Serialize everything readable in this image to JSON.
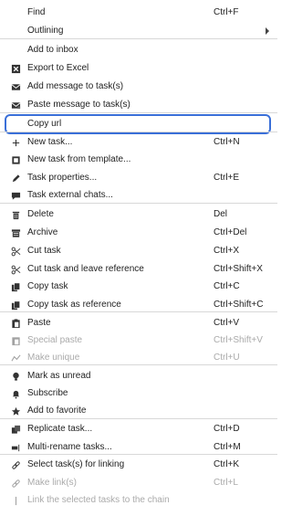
{
  "menu": {
    "items": [
      {
        "label": "Find",
        "shortcut": "Ctrl+F",
        "icon": "none",
        "disabled": false
      },
      {
        "label": "Outlining",
        "shortcut": "",
        "icon": "none",
        "disabled": false,
        "submenu": true
      },
      {
        "label": "Add to inbox",
        "shortcut": "",
        "icon": "none",
        "disabled": false
      },
      {
        "label": "Export to Excel",
        "shortcut": "",
        "icon": "excel-icon",
        "disabled": false
      },
      {
        "label": "Add message to task(s)",
        "shortcut": "",
        "icon": "envelope-icon",
        "disabled": false
      },
      {
        "label": "Paste message to task(s)",
        "shortcut": "",
        "icon": "envelope-paste-icon",
        "disabled": false
      },
      {
        "label": "Copy url",
        "shortcut": "",
        "icon": "none",
        "disabled": false
      },
      {
        "label": "New task...",
        "shortcut": "Ctrl+N",
        "icon": "plus-icon",
        "disabled": false
      },
      {
        "label": "New task from template...",
        "shortcut": "",
        "icon": "template-icon",
        "disabled": false
      },
      {
        "label": "Task properties...",
        "shortcut": "Ctrl+E",
        "icon": "pencil-icon",
        "disabled": false
      },
      {
        "label": "Task external chats...",
        "shortcut": "",
        "icon": "chat-icon",
        "disabled": false
      },
      {
        "label": "Delete",
        "shortcut": "Del",
        "icon": "trash-icon",
        "disabled": false
      },
      {
        "label": "Archive",
        "shortcut": "Ctrl+Del",
        "icon": "archive-icon",
        "disabled": false
      },
      {
        "label": "Cut task",
        "shortcut": "Ctrl+X",
        "icon": "scissors-icon",
        "disabled": false
      },
      {
        "label": "Cut task and leave reference",
        "shortcut": "Ctrl+Shift+X",
        "icon": "scissors-ref-icon",
        "disabled": false
      },
      {
        "label": "Copy task",
        "shortcut": "Ctrl+C",
        "icon": "copy-icon",
        "disabled": false
      },
      {
        "label": "Copy task as reference",
        "shortcut": "Ctrl+Shift+C",
        "icon": "copy-ref-icon",
        "disabled": false
      },
      {
        "label": "Paste",
        "shortcut": "Ctrl+V",
        "icon": "paste-icon",
        "disabled": false
      },
      {
        "label": "Special paste",
        "shortcut": "Ctrl+Shift+V",
        "icon": "special-paste-icon",
        "disabled": true
      },
      {
        "label": "Make unique",
        "shortcut": "Ctrl+U",
        "icon": "unique-icon",
        "disabled": true
      },
      {
        "label": "Mark as unread",
        "shortcut": "",
        "icon": "bulb-icon",
        "disabled": false
      },
      {
        "label": "Subscribe",
        "shortcut": "",
        "icon": "bell-icon",
        "disabled": false
      },
      {
        "label": "Add to favorite",
        "shortcut": "",
        "icon": "star-icon",
        "disabled": false
      },
      {
        "label": "Replicate task...",
        "shortcut": "Ctrl+D",
        "icon": "replicate-icon",
        "disabled": false
      },
      {
        "label": "Multi-rename tasks...",
        "shortcut": "Ctrl+M",
        "icon": "rename-icon",
        "disabled": false
      },
      {
        "label": "Select task(s) for linking",
        "shortcut": "Ctrl+K",
        "icon": "link-icon",
        "disabled": false
      },
      {
        "label": "Make link(s)",
        "shortcut": "Ctrl+L",
        "icon": "link-icon",
        "disabled": true
      },
      {
        "label": "Link the selected tasks to the chain",
        "shortcut": "",
        "icon": "chain-icon",
        "disabled": true
      }
    ]
  },
  "colors": {
    "highlight": "#3a6fd8",
    "separator": "#d8d8d8",
    "disabled": "#aaaaaa"
  }
}
